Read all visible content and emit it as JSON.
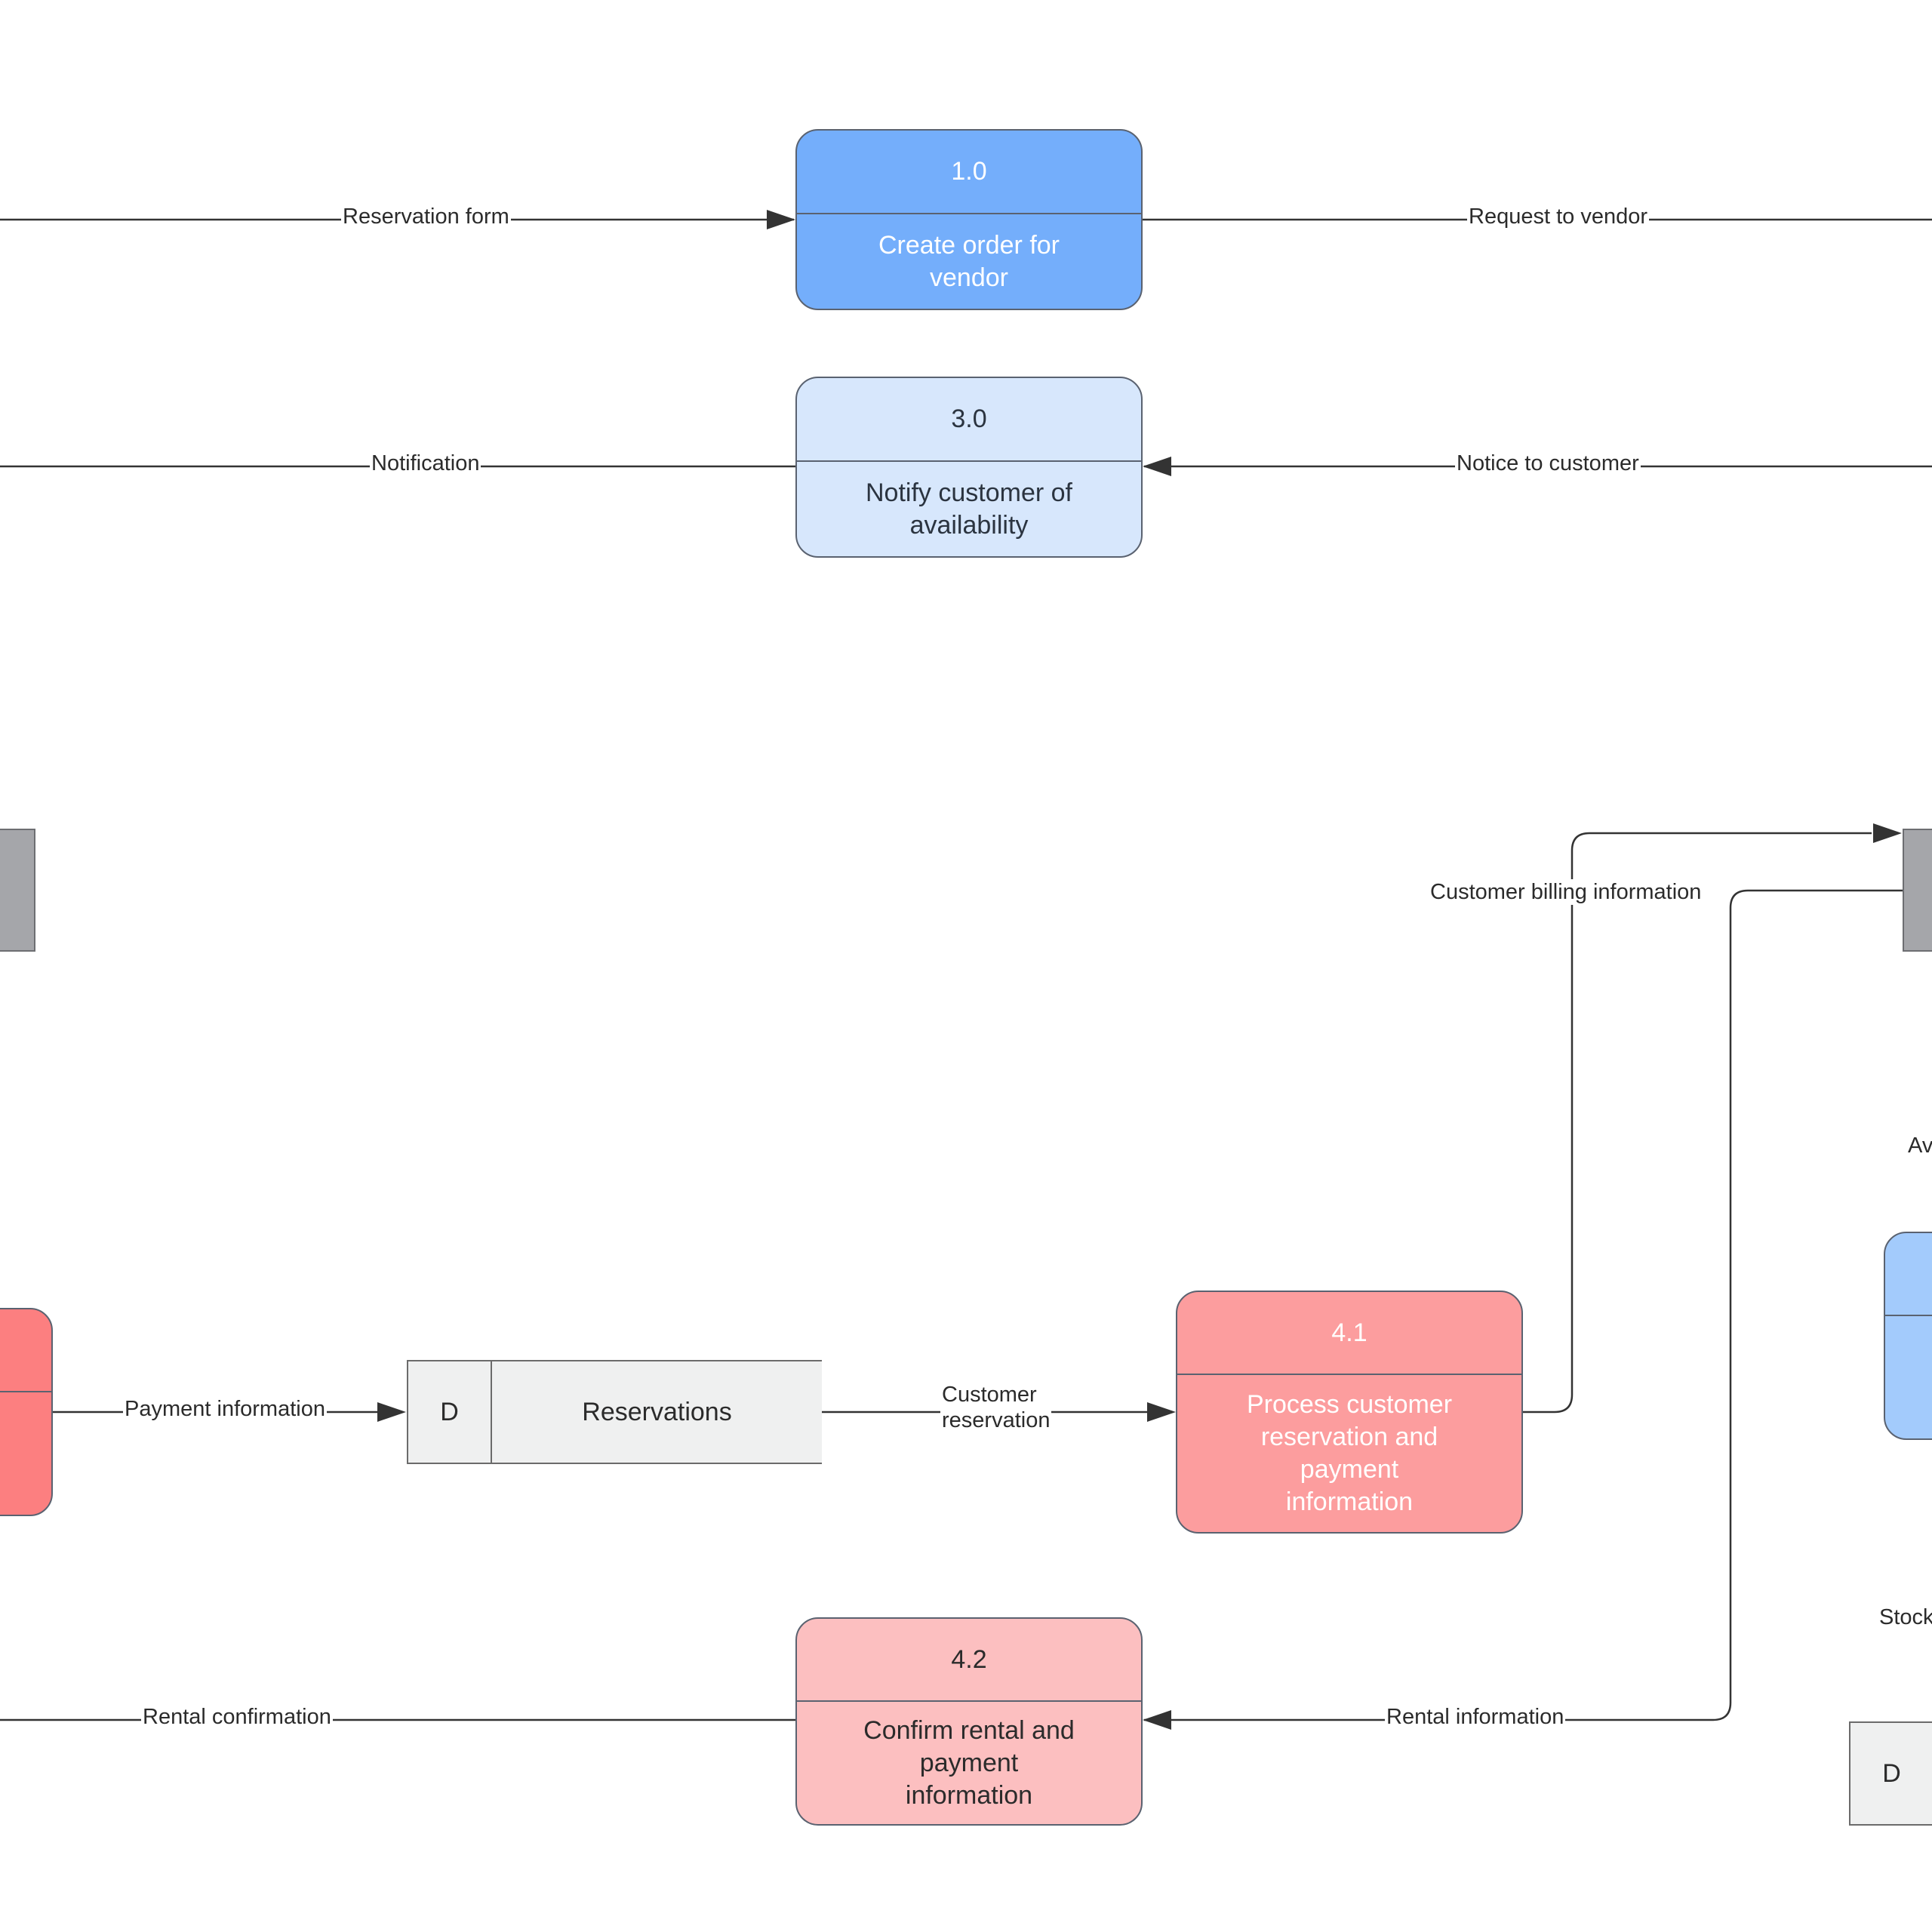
{
  "diagram": {
    "type": "data-flow-diagram",
    "processes": [
      {
        "id": "1.0",
        "name": "Create order for\nvendor",
        "fill": "#74aefb",
        "text_color": "#ffffff"
      },
      {
        "id": "3.0",
        "name": "Notify customer of\navailability",
        "fill": "#d7e7fc",
        "text_color": "#2b3440"
      },
      {
        "id": "4.1",
        "name": "Process customer\nreservation and\npayment\ninformation",
        "fill": "#fc9d9e",
        "text_color": "#ffffff"
      },
      {
        "id": "4.2",
        "name": "Confirm rental and\npayment\ninformation",
        "fill": "#fcbfc0",
        "text_color": "#2b2b2b"
      },
      {
        "id": "",
        "name": "",
        "fill": "#a3cbfc",
        "text_color": "#ffffff",
        "note": "partially visible process at right edge"
      },
      {
        "id": "",
        "name": "",
        "fill": "#fc7f80",
        "text_color": "#ffffff",
        "note": "partially visible process at left edge"
      }
    ],
    "data_stores": [
      {
        "id": "D",
        "name": "Reservations"
      },
      {
        "id": "D",
        "name": ""
      }
    ],
    "external_entities": [
      {
        "name": "",
        "note": "gray entity partially visible at left edge"
      },
      {
        "name": "",
        "note": "gray entity partially visible at right edge"
      }
    ],
    "flows": [
      {
        "label": "Reservation form",
        "to": "1.0"
      },
      {
        "label": "Request to vendor",
        "from": "1.0"
      },
      {
        "label": "Notification",
        "from": "3.0"
      },
      {
        "label": "Notice to customer",
        "to": "3.0"
      },
      {
        "label": "Payment information",
        "to": "Reservations"
      },
      {
        "label": "Customer\nreservation",
        "from": "Reservations",
        "to": "4.1"
      },
      {
        "label": "Customer billing information",
        "from": "4.1"
      },
      {
        "label": "Rental information",
        "to": "4.2"
      },
      {
        "label": "Rental confirmation",
        "from": "4.2"
      }
    ],
    "partial_labels": [
      "Av",
      "Stock"
    ],
    "colors": {
      "line": "#333333",
      "border": "#5a6270",
      "entity_fill": "#a5a6aa",
      "store_fill": "#eff0f0",
      "background": "#ffffff"
    }
  }
}
